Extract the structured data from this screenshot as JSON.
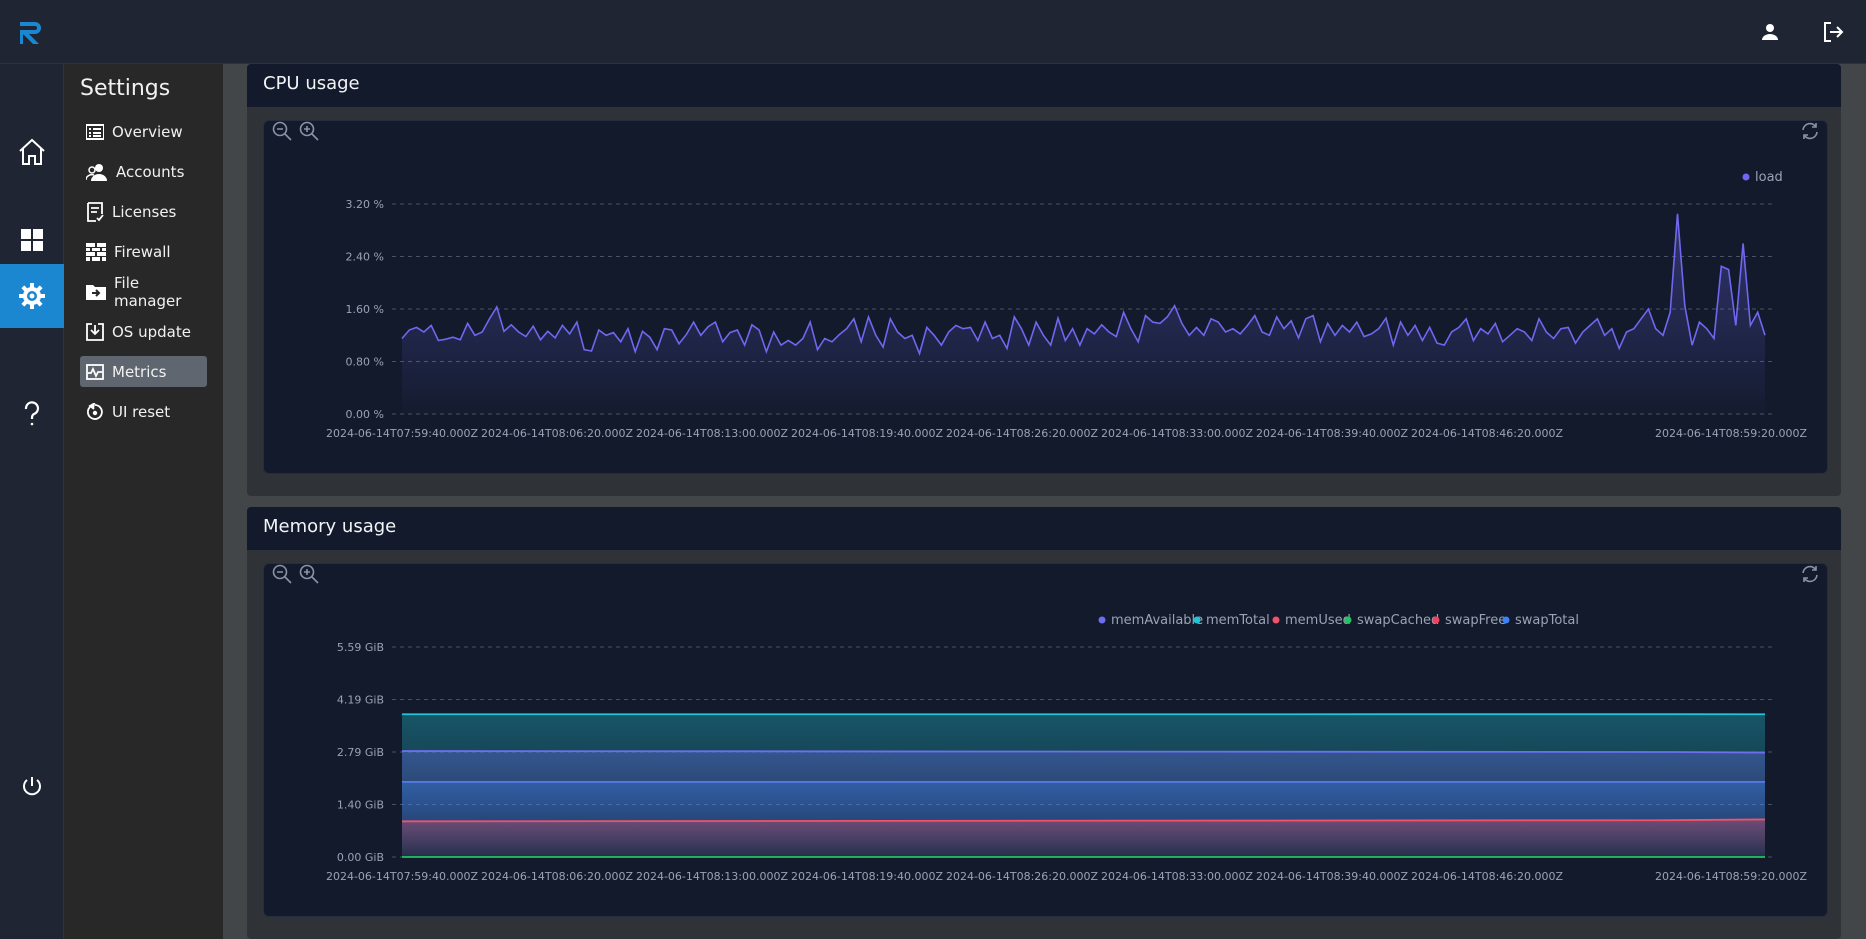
{
  "sidebar_title": "Settings",
  "menu": [
    {
      "label": "Overview",
      "icon": "list-icon"
    },
    {
      "label": "Accounts",
      "icon": "users-icon"
    },
    {
      "label": "Licenses",
      "icon": "license-icon"
    },
    {
      "label": "Firewall",
      "icon": "firewall-icon"
    },
    {
      "label": "File manager",
      "icon": "folder-icon"
    },
    {
      "label": "OS update",
      "icon": "download-icon"
    },
    {
      "label": "Metrics",
      "icon": "metrics-icon",
      "active": true
    },
    {
      "label": "UI reset",
      "icon": "reset-icon"
    }
  ],
  "rail": [
    "home-icon",
    "grid-icon",
    "gear-icon",
    "help-icon",
    "power-icon"
  ],
  "colors": {
    "accent": "#1a87d0",
    "cpu_load": "#6f67ef",
    "memAvailable": "#6b6ff0",
    "memTotal": "#21c3d6",
    "memUsed": "#f1526a",
    "swapCached": "#22c55e",
    "swapFree": "#f43f5e",
    "swapTotal": "#3b82f6"
  },
  "cpu_panel": {
    "title": "CPU usage"
  },
  "memory_panel": {
    "title": "Memory usage"
  },
  "chart_data": [
    {
      "type": "line",
      "title": "CPU usage",
      "x_tick_labels": [
        "2024-06-14T07:59:40.000Z",
        "2024-06-14T08:06:20.000Z",
        "2024-06-14T08:13:00.000Z",
        "2024-06-14T08:19:40.000Z",
        "2024-06-14T08:26:20.000Z",
        "2024-06-14T08:33:00.000Z",
        "2024-06-14T08:39:40.000Z",
        "2024-06-14T08:46:20.000Z",
        "2024-06-14T08:59:20.000Z"
      ],
      "y_tick_labels": [
        "0.00 %",
        "0.80 %",
        "1.60 %",
        "2.40 %",
        "3.20 %"
      ],
      "ylim": [
        0,
        3.2
      ],
      "grid": true,
      "legend_position": "top-right",
      "series": [
        {
          "name": "load",
          "values": [
            1.15,
            1.28,
            1.32,
            1.25,
            1.35,
            1.12,
            1.14,
            1.17,
            1.13,
            1.38,
            1.2,
            1.25,
            1.45,
            1.63,
            1.26,
            1.36,
            1.25,
            1.18,
            1.34,
            1.13,
            1.26,
            1.16,
            1.35,
            1.22,
            1.4,
            0.98,
            0.96,
            1.28,
            1.2,
            1.24,
            1.1,
            1.3,
            0.95,
            1.26,
            1.17,
            0.98,
            1.3,
            1.28,
            1.07,
            1.21,
            1.4,
            1.2,
            1.33,
            1.4,
            1.1,
            1.24,
            1.28,
            1.05,
            1.36,
            1.28,
            0.95,
            1.25,
            1.05,
            1.12,
            1.05,
            1.15,
            1.4,
            0.98,
            1.15,
            1.1,
            1.21,
            1.3,
            1.45,
            1.1,
            1.48,
            1.2,
            1.02,
            1.45,
            1.25,
            1.15,
            1.2,
            0.92,
            1.32,
            1.2,
            1.05,
            1.25,
            1.35,
            1.3,
            1.32,
            1.12,
            1.4,
            1.15,
            1.2,
            1.0,
            1.48,
            1.3,
            1.05,
            1.4,
            1.2,
            1.05,
            1.46,
            1.12,
            1.3,
            1.05,
            1.3,
            1.22,
            1.36,
            1.25,
            1.18,
            1.55,
            1.3,
            1.1,
            1.5,
            1.4,
            1.38,
            1.48,
            1.65,
            1.38,
            1.2,
            1.32,
            1.2,
            1.45,
            1.4,
            1.25,
            1.3,
            1.22,
            1.35,
            1.5,
            1.25,
            1.2,
            1.48,
            1.3,
            1.42,
            1.16,
            1.45,
            1.5,
            1.1,
            1.38,
            1.2,
            1.35,
            1.25,
            1.4,
            1.18,
            1.22,
            1.3,
            1.46,
            1.05,
            1.4,
            1.2,
            1.35,
            1.12,
            1.32,
            1.08,
            1.05,
            1.25,
            1.32,
            1.45,
            1.12,
            1.3,
            1.22,
            1.38,
            1.1,
            1.2,
            1.3,
            1.25,
            1.12,
            1.45,
            1.25,
            1.15,
            1.3,
            1.32,
            1.08,
            1.25,
            1.35,
            1.45,
            1.2,
            1.3,
            1.0,
            1.25,
            1.3,
            1.45,
            1.6,
            1.3,
            1.2,
            1.55,
            3.05,
            1.65,
            1.05,
            1.4,
            1.3,
            1.15,
            2.25,
            2.2,
            1.35,
            2.6,
            1.35,
            1.55,
            1.2
          ]
        }
      ]
    },
    {
      "type": "area",
      "title": "Memory usage",
      "x_tick_labels": [
        "2024-06-14T07:59:40.000Z",
        "2024-06-14T08:06:20.000Z",
        "2024-06-14T08:13:00.000Z",
        "2024-06-14T08:19:40.000Z",
        "2024-06-14T08:26:20.000Z",
        "2024-06-14T08:33:00.000Z",
        "2024-06-14T08:39:40.000Z",
        "2024-06-14T08:46:20.000Z",
        "2024-06-14T08:59:20.000Z"
      ],
      "y_tick_labels": [
        "0.00 GiB",
        "1.40 GiB",
        "2.79 GiB",
        "4.19 GiB",
        "5.59 GiB"
      ],
      "ylim": [
        0,
        5.59
      ],
      "grid": true,
      "legend_position": "top-right",
      "series": [
        {
          "name": "memAvailable",
          "start": 2.82,
          "end": 2.78
        },
        {
          "name": "memTotal",
          "start": 3.8,
          "end": 3.8
        },
        {
          "name": "memUsed",
          "start": 0.95,
          "end": 1.0
        },
        {
          "name": "swapCached",
          "start": 0.0,
          "end": 0.0
        },
        {
          "name": "swapFree",
          "start": 2.0,
          "end": 2.0
        },
        {
          "name": "swapTotal",
          "start": 2.0,
          "end": 2.0
        }
      ]
    }
  ]
}
